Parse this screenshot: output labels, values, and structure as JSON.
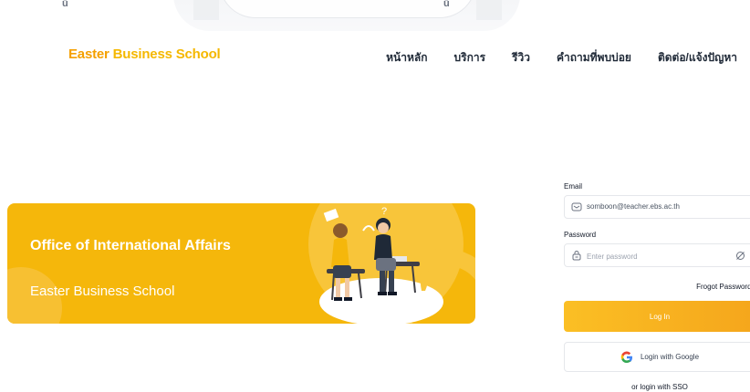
{
  "nav": {
    "brand_part1": "Easter",
    "brand_part2": "Business School",
    "links": [
      "หน้าหลัก",
      "บริการ",
      "รีวิว",
      "คำถามที่พบบ่อย",
      "ติดต่อ/แจ้งปัญหา"
    ]
  },
  "banner": {
    "title": "Office of International Affairs",
    "subtitle": "Easter Business School"
  },
  "login": {
    "email_label": "Email",
    "email_value": "somboon@teacher.ebs.ac.th",
    "password_label": "Password",
    "password_placeholder": "Enter password",
    "forgot_label": "Frogot Password?",
    "login_button": "Log In",
    "google_button": "Login with Google",
    "sso_text": "or login with SSO"
  },
  "colors": {
    "accent": "#f5b70b",
    "brand_orange": "#f5a000"
  },
  "icons": {
    "email": "mail-icon",
    "password": "lock-icon",
    "toggle": "eye-off-icon",
    "google": "google-icon"
  }
}
